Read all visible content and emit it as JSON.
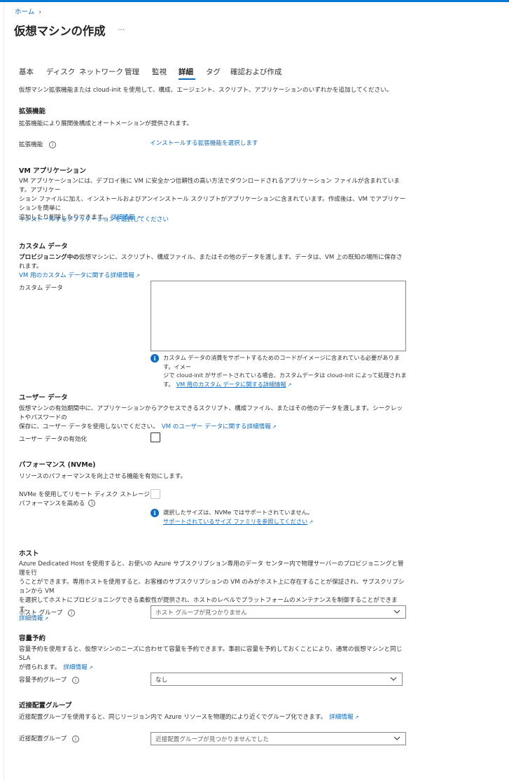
{
  "breadcrumb": {
    "home": "ホーム",
    "separator": "›"
  },
  "page": {
    "title": "仮想マシンの作成",
    "more": "…"
  },
  "tabs": [
    {
      "label": "基本"
    },
    {
      "label": "ディスク"
    },
    {
      "label": "ネットワーク"
    },
    {
      "label": "管理"
    },
    {
      "label": "監視"
    },
    {
      "label": "詳細"
    },
    {
      "label": "タグ"
    },
    {
      "label": "確認および作成"
    }
  ],
  "intro": "仮想マシン拡張機能または cloud-init を使用して、構成、エージェント、スクリプト、アプリケーションのいずれかを追加してください。",
  "extensions": {
    "heading": "拡張機能",
    "description": "拡張機能により展開後構成とオートメーションが提供されます。",
    "field_label": "拡張機能",
    "select_link": "インストールする拡張機能を選択します"
  },
  "vm_apps": {
    "heading": "VM アプリケーション",
    "line1": "VM アプリケーションには、デプロイ後に VM に安全かつ信頼性の高い方法でダウンロードされるアプリケーション ファイルが含まれています。アプリケー",
    "line2": "ション ファイルに加え、インストールおよびアンインストール スクリプトがアプリケーションに含まれています。作成後は、VM でアプリケーションを簡単に",
    "line3": "追加したり削除したりできます。",
    "learn_more": "詳細情報",
    "select_link": "インストールするアプリケーションを選択してください"
  },
  "custom_data": {
    "heading": "カスタム データ",
    "desc_bold": "プロビジョニング中の",
    "desc_rest": "仮想マシンに、スクリプト、構成ファイル、またはその他のデータを渡します。データは、VM 上の既知の場所に保存されます。",
    "learn_link": "VM 用のカスタム データに関する詳細情報",
    "field_label": "カスタム データ",
    "note_line1": "カスタム データの消費をサポートするためのコードがイメージに含まれている必要があります。イメー",
    "note_line2": "ジで cloud-init がサポートされている場合、カスタムデータは cloud-init によって処理されま",
    "note_line3": "す。",
    "note_link": "VM 用のカスタム データに関する詳細情報"
  },
  "user_data": {
    "heading": "ユーザー データ",
    "line1": "仮想マシンの有効期間中に、アプリケーションからアクセスできるスクリプト、構成ファイル、またはその他のデータを渡します。シークレットやパスワードの",
    "line2": "保存に、ユーザー データを使用しないでください。",
    "learn_link": "VM のユーザー データに関する詳細情報",
    "field_label": "ユーザー データの有効化"
  },
  "performance": {
    "heading": "パフォーマンス (NVMe)",
    "description": "リソースのパフォーマンスを向上させる機能を有効にします。",
    "field_label_line1": "NVMe を使用してリモート ディスク ストレージ",
    "field_label_line2": "パフォーマンスを高める",
    "note_text": "選択したサイズは、NVMe ではサポートされていません。",
    "note_link": "サポートされているサイズ ファミリを参照してください"
  },
  "host": {
    "heading": "ホスト",
    "line1": "Azure Dedicated Host を使用すると、お使いの Azure サブスクリプション専用のデータ センター内で物理サーバーのプロビジョニングと管理を行",
    "line2": "うことができます。専用ホストを使用すると、お客様のサブスクリプションの VM のみがホスト上に存在することが保証され、サブスクリプションから VM",
    "line3": "を選択してホストにプロビジョニングできる柔軟性が提供され、ホストのレベルでプラットフォームのメンテナンスを制御することができます。",
    "learn_more": "詳細情報",
    "field_label": "ホスト グループ",
    "select_value": "ホスト グループが見つかりません"
  },
  "capacity": {
    "heading": "容量予約",
    "line1": "容量予約を使用すると、仮想マシンのニーズに合わせて容量を予約できます。事前に容量を予約しておくことにより、通常の仮想マシンと同じ SLA",
    "line2": "が得られます。",
    "learn_more": "詳細情報",
    "field_label": "容量予約グループ",
    "select_value": "なし"
  },
  "proximity": {
    "heading": "近接配置グループ",
    "description": "近接配置グループを使用すると、同じリージョン内で Azure リソースを物理的により近くでグループ化できます。",
    "learn_more": "詳細情報",
    "field_label": "近接配置グループ",
    "select_value": "近接配置グループが見つかりませんでした"
  },
  "icons": {
    "info": "i",
    "external": "↗"
  },
  "colors": {
    "accent": "#0078d4",
    "link": "#0f6cbd",
    "text": "#323130"
  }
}
